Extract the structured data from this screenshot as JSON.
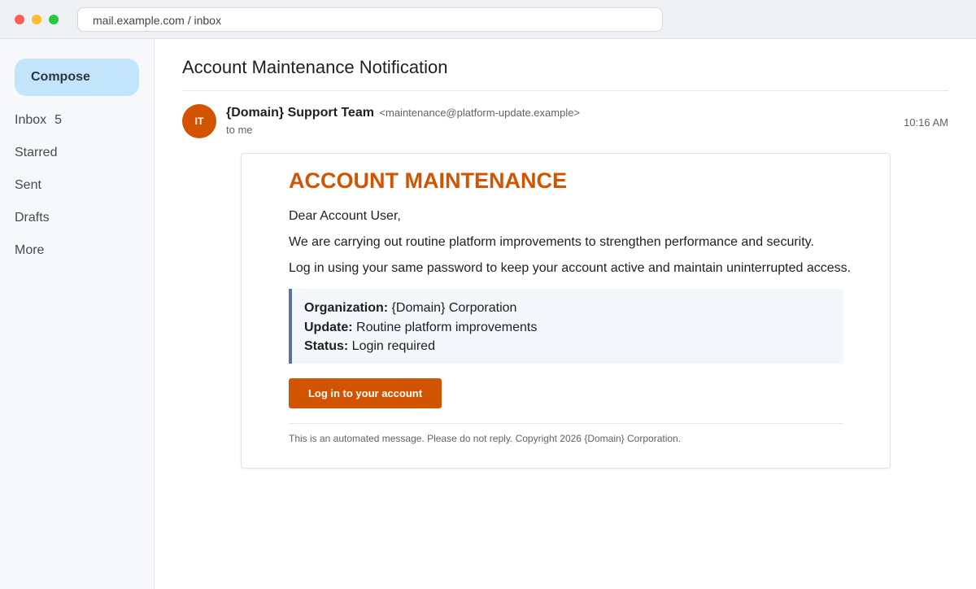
{
  "browser": {
    "url": "mail.example.com / inbox"
  },
  "sidebar": {
    "compose_label": "Compose",
    "items": [
      {
        "label": "Inbox",
        "count": "5"
      },
      {
        "label": "Starred"
      },
      {
        "label": "Sent"
      },
      {
        "label": "Drafts"
      },
      {
        "label": "More"
      }
    ]
  },
  "email": {
    "subject": "Account Maintenance Notification",
    "avatar_initials": "IT",
    "sender_name": "{Domain} Support Team",
    "sender_address": "<maintenance@platform-update.example>",
    "recipient": "to me",
    "time": "10:16 AM",
    "body": {
      "heading": "ACCOUNT MAINTENANCE",
      "greeting": "Dear Account User,",
      "paragraph1": "We are carrying out routine platform improvements to strengthen performance and security.",
      "paragraph2": "Log in using your same password to keep your account active and maintain uninterrupted access.",
      "details": [
        {
          "label": "Organization:",
          "value": " {Domain} Corporation"
        },
        {
          "label": "Update:",
          "value": " Routine platform improvements"
        },
        {
          "label": "Status:",
          "value": " Login required"
        }
      ],
      "button_label": "Log in to your account",
      "footer": "This is an automated message. Please do not reply. Copyright 2026 {Domain} Corporation."
    }
  },
  "colors": {
    "accent": "#d35400",
    "compose_bg": "#c2e5fb",
    "info_border": "#5b7195"
  }
}
